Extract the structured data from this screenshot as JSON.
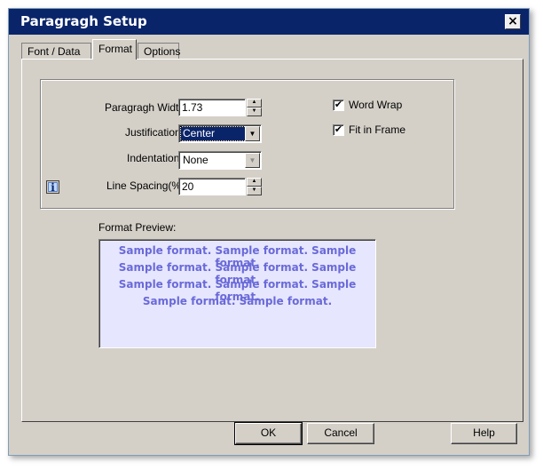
{
  "window": {
    "title": "Paragragh Setup",
    "close_label": "×"
  },
  "tabs": [
    {
      "label": "Font  /  Data",
      "active": false
    },
    {
      "label": "Format",
      "active": true
    },
    {
      "label": "Options",
      "active": false
    }
  ],
  "format": {
    "paragraph_width": {
      "label": "Paragragh Width",
      "value": "1.73"
    },
    "justification": {
      "label": "Justification",
      "value": "Center"
    },
    "indentation": {
      "label": "Indentation",
      "value": "None"
    },
    "line_spacing": {
      "label": "Line Spacing(%)",
      "value": "20"
    },
    "word_wrap": {
      "label": "Word Wrap",
      "checked": true,
      "mark": "✔"
    },
    "fit_in_frame": {
      "label": "Fit in Frame",
      "checked": true,
      "mark": "✔"
    }
  },
  "info_icon_glyph": "i",
  "preview": {
    "label": "Format Preview:",
    "lines": [
      "Sample format.  Sample format.  Sample format.",
      "Sample format.  Sample format.  Sample format.",
      "Sample format.  Sample format.  Sample format.",
      "Sample format.  Sample format."
    ],
    "text_color": "#6a6ad8",
    "background_color": "#e6e6ff"
  },
  "buttons": {
    "ok": "OK",
    "cancel": "Cancel",
    "help": "Help"
  },
  "colors": {
    "titlebar": "#0a246a",
    "dialog_face": "#d4d0c8"
  }
}
